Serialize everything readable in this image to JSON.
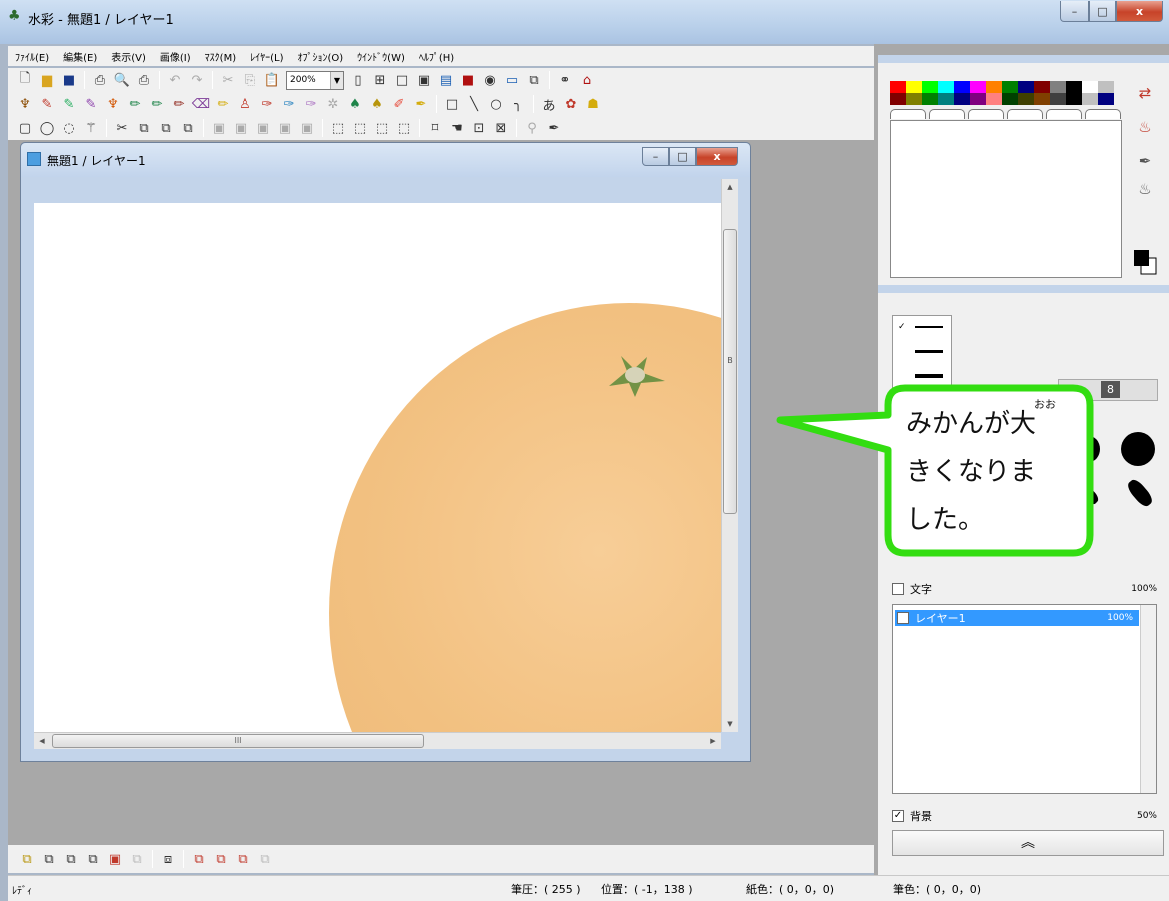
{
  "window": {
    "title": "水彩 - 無題1 / レイヤー1",
    "controls": {
      "minimize": "–",
      "maximize": "□",
      "close": "x"
    }
  },
  "menu": [
    "ﾌｧｲﾙ(E)",
    "編集(E)",
    "表示(V)",
    "画像(I)",
    "ﾏｽｸ(M)",
    "ﾚｲﾔｰ(L)",
    "ｵﾌﾟｼｮﾝ(O)",
    "ｳｲﾝﾄﾞｳ(W)",
    "ﾍﾙﾌﾟ(H)"
  ],
  "toolbar": {
    "zoom_value": "200%"
  },
  "document": {
    "title": "無題1 / レイヤー1",
    "scroll_right_label": "B",
    "scroll_thumb_grip": "III"
  },
  "status": {
    "ready": "ﾚﾃﾞｨ",
    "pressure": "筆圧：( 255 )",
    "position": "位置：( -1，138 )",
    "paper_color": "紙色：( 0，0，0)",
    "brush_color": "筆色：( 0，0，0)"
  },
  "palette": {
    "colors": [
      "#ff0000",
      "#ffff00",
      "#00ff00",
      "#00ffff",
      "#0000ff",
      "#ff00ff",
      "#ff8000",
      "#008000",
      "#000080",
      "#800000",
      "#808080",
      "#000000",
      "#ffffff",
      "#c0c0c0",
      "#800000",
      "#808000",
      "#008000",
      "#008080",
      "#000080",
      "#800080",
      "#ff8080",
      "#004000",
      "#404000",
      "#804000",
      "#404040",
      "#000000",
      "#c0c0c0",
      "#000080"
    ]
  },
  "brush": {
    "size": "8"
  },
  "layers": {
    "items": [
      {
        "name": "文字",
        "opacity": "100%",
        "checked": false
      },
      {
        "name": "レイヤー1",
        "opacity": "100%",
        "checked": true
      },
      {
        "name": "背景",
        "opacity": "50%",
        "checked": true
      }
    ],
    "expand_label": "︽"
  },
  "callout": {
    "line1": "みかんが大",
    "line2": "きくなりま",
    "line3": "した。",
    "ruby": "おお",
    "fill": "#ffffff",
    "stroke": "#33dd11"
  }
}
